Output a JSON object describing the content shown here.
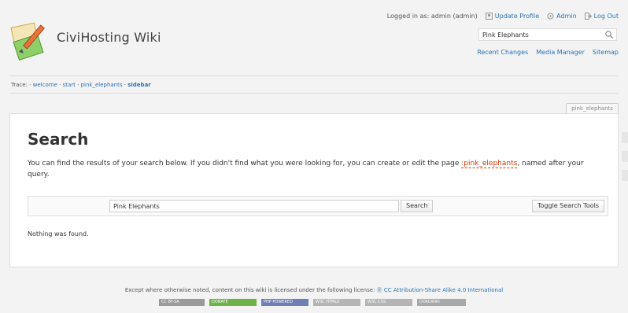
{
  "header": {
    "title": "CiviHosting Wiki",
    "logo": "wiki-logo-icon",
    "user_tools": {
      "logged_in": "Logged in as: admin (admin)",
      "update_profile": "Update Profile",
      "admin": "Admin",
      "logout": "Log Out"
    },
    "search_value": "Pink Elephants",
    "site_tools": {
      "recent_changes": "Recent Changes",
      "media_manager": "Media Manager",
      "sitemap": "Sitemap"
    }
  },
  "breadcrumbs": {
    "label": "Trace:",
    "items": [
      "welcome",
      "start",
      "pink_elephants"
    ],
    "current": "sidebar",
    "sep": "·"
  },
  "page_id": "pink_elephants",
  "main": {
    "heading": "Search",
    "intro_before": "You can find the results of your search below. If you didn't find what you were looking for, you can create or edit the page ",
    "intro_link": ":pink_elephants",
    "intro_after": ", named after your query.",
    "query": "Pink Elephants",
    "search_button": "Search",
    "toggle_button": "Toggle Search Tools",
    "result": "Nothing was found."
  },
  "footer": {
    "license_text": "Except where otherwise noted, content on this wiki is licensed under the following license:",
    "license_link": "CC Attribution-Share Alike 4.0 International",
    "badges": [
      {
        "label": "CC BY-SA",
        "color": "#9a9a9a"
      },
      {
        "label": "DONATE",
        "color": "#6db34a"
      },
      {
        "label": "PHP POWERED",
        "color": "#6f7fb3"
      },
      {
        "label": "W3C HTML5",
        "color": "#b5b5b5"
      },
      {
        "label": "W3C CSS",
        "color": "#b5b5b5"
      },
      {
        "label": "DOKUWIKI",
        "color": "#a8a8a8"
      }
    ]
  },
  "colors": {
    "link": "#2b73b7",
    "missing_link": "#dd3300"
  }
}
